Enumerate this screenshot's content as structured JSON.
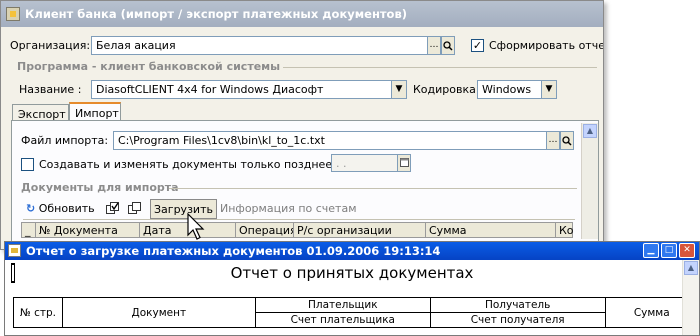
{
  "main_window": {
    "title": "Клиент банка (импорт / экспорт платежных документов)",
    "org_label": "Организация:",
    "org_value": "Белая акация",
    "form_report_label": "Сформировать отчет",
    "form_report_checked": true,
    "program_section": "Программа - клиент банковской системы",
    "name_label": "Название :",
    "name_value": "DiasoftCLIENT 4x4 for Windows Диасофт",
    "encoding_label": "Кодировка:",
    "encoding_value": "Windows",
    "tabs": [
      {
        "label": "Экспорт",
        "active": false
      },
      {
        "label": "Импорт",
        "active": true
      }
    ],
    "import": {
      "file_label": "Файл импорта:",
      "file_value": "C:\\Program Files\\1cv8\\bin\\kl_to_1c.txt",
      "create_change_label": "Создавать и изменять документы только позднее даты:",
      "create_change_checked": false,
      "date_value": ".   .",
      "docs_section": "Документы для импорта",
      "toolbar": {
        "refresh": "Обновить",
        "load": "Загрузить",
        "account_info": "Информация по счетам"
      },
      "columns": [
        "№ Документа",
        "Дата",
        "Операция",
        "Р/с организации",
        "Сумма",
        "Кон"
      ]
    },
    "accent_colors": {
      "title_bar": "#a8b3c4",
      "tab_highlight": "#e68b2c"
    }
  },
  "report_window": {
    "title": "Отчет о загрузке платежных документов 01.09.2006 19:13:14",
    "heading": "Отчет о принятых документах",
    "table": {
      "col_num": "№ стр.",
      "col_doc": "Документ",
      "col_payer": "Плательщик",
      "col_payer_acc": "Счет плательщика",
      "col_receiver": "Получатель",
      "col_receiver_acc": "Счет получателя",
      "col_sum": "Сумма"
    },
    "title_bar_color": "#0a5de7"
  },
  "icons": [
    "app-icon",
    "select-ellipsis-icon",
    "search-icon",
    "dropdown-arrow-icon",
    "calendar-icon",
    "refresh-icon",
    "check-all-icon",
    "uncheck-all-icon",
    "scroll-up-icon",
    "minimize-icon",
    "maximize-icon",
    "close-icon",
    "mouse-cursor-icon"
  ]
}
